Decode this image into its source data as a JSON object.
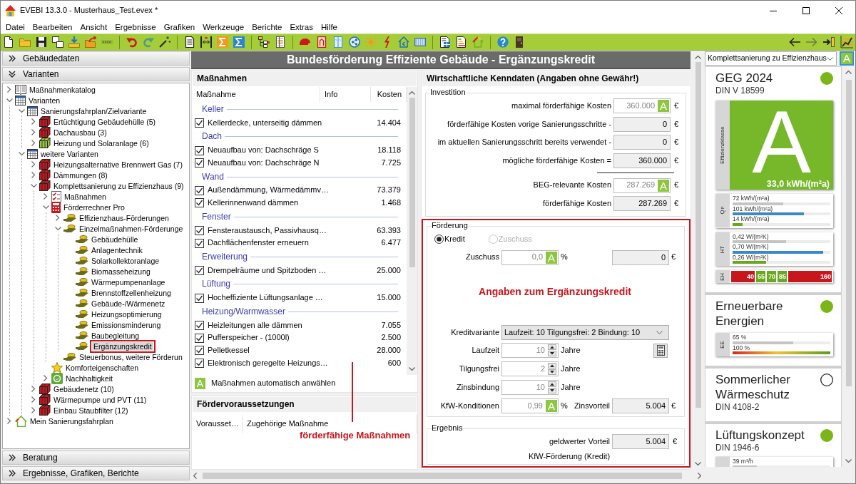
{
  "window": {
    "title": "EVEBI 13.3.0 - Musterhaus_Test.evex *"
  },
  "menu": [
    "Datei",
    "Bearbeiten",
    "Ansicht",
    "Ergebnisse",
    "Grafiken",
    "Werkzeuge",
    "Berichte",
    "Extras",
    "Hilfe"
  ],
  "sidebar": {
    "top_sections": [
      {
        "title": "Gebäudedaten",
        "expanded": false
      },
      {
        "title": "Varianten",
        "expanded": true
      }
    ],
    "tree": [
      {
        "label": "Maßnahmenkatalog",
        "kind": "catalog",
        "expanded": false,
        "selected": false
      },
      {
        "label": "Varianten",
        "kind": "group",
        "expanded": true,
        "selected": false,
        "children": [
          {
            "label": "Sanierungsfahrplan/Zielvariante",
            "kind": "group",
            "expanded": true,
            "selected": false,
            "children": [
              {
                "label": "Ertüchtigung Gebäudehülle (5)",
                "kind": "variant",
                "color": "#c8161d",
                "expanded": false,
                "selected": false
              },
              {
                "label": "Dachausbau (3)",
                "kind": "variant",
                "color": "#c8161d",
                "expanded": false,
                "selected": false
              },
              {
                "label": "Heizung und Solaranlage (6)",
                "kind": "variant",
                "color": "#9bc53d",
                "expanded": false,
                "selected": false
              }
            ]
          },
          {
            "label": "weitere Varianten",
            "kind": "group",
            "expanded": true,
            "selected": false,
            "children": [
              {
                "label": "Heizungsalternative Brennwert Gas (7)",
                "kind": "variant",
                "color": "#c8161d",
                "expanded": false,
                "selected": false
              },
              {
                "label": "Dämmungen (8)",
                "kind": "variant",
                "color": "#c8161d",
                "expanded": false,
                "selected": false
              },
              {
                "label": "Komplettsanierung zu Effizienzhaus (9)",
                "kind": "variant",
                "color": "#c8161d",
                "expanded": true,
                "selected": false,
                "children": [
                  {
                    "label": "Maßnahmen",
                    "kind": "measures",
                    "expanded": false,
                    "selected": false
                  },
                  {
                    "label": "Förderrechner Pro",
                    "kind": "calculator",
                    "expanded": true,
                    "selected": false,
                    "children": [
                      {
                        "label": "Effizienzhaus-Förderungen",
                        "kind": "funding",
                        "expanded": false,
                        "selected": false
                      },
                      {
                        "label": "Einzelmaßnahmen-Förderunge",
                        "kind": "funding",
                        "expanded": true,
                        "selected": false,
                        "children": [
                          {
                            "label": "Gebäudehülle",
                            "kind": "funding",
                            "selected": false
                          },
                          {
                            "label": "Anlagentechnik",
                            "kind": "funding",
                            "selected": false
                          },
                          {
                            "label": "Solarkollektoranlage",
                            "kind": "funding",
                            "selected": false
                          },
                          {
                            "label": "Biomasseheizung",
                            "kind": "funding",
                            "selected": false
                          },
                          {
                            "label": "Wärmepumpenanlage",
                            "kind": "funding",
                            "selected": false
                          },
                          {
                            "label": "Brennstoffzellenheizung",
                            "kind": "funding",
                            "selected": false
                          },
                          {
                            "label": "Gebäude-/Wärmenetz",
                            "kind": "funding",
                            "selected": false
                          },
                          {
                            "label": "Heizungsoptimierung",
                            "kind": "funding",
                            "selected": false
                          },
                          {
                            "label": "Emissionsminderung",
                            "kind": "funding",
                            "selected": false
                          },
                          {
                            "label": "Baubegleitung",
                            "kind": "funding",
                            "selected": false
                          },
                          {
                            "label": "Ergänzungskredit",
                            "kind": "funding",
                            "selected": true,
                            "annotated": true
                          }
                        ]
                      },
                      {
                        "label": "Steuerbonus, weitere Förderun",
                        "kind": "funding",
                        "selected": false
                      }
                    ]
                  },
                  {
                    "label": "Komforteigenschaften",
                    "kind": "star",
                    "selected": false
                  },
                  {
                    "label": "Nachhaltigkeit",
                    "kind": "sustainability",
                    "expanded": false,
                    "selected": false
                  }
                ]
              },
              {
                "label": "Gebäudenetz (10)",
                "kind": "variant",
                "color": "#c8161d",
                "expanded": false,
                "selected": false
              },
              {
                "label": "Wärmepumpe und PVT (11)",
                "kind": "variant",
                "color": "#c8161d",
                "expanded": false,
                "selected": false
              },
              {
                "label": "Einbau Staubfilter (12)",
                "kind": "variant",
                "color": "#c8161d",
                "expanded": false,
                "selected": false
              }
            ]
          }
        ]
      },
      {
        "label": "Mein Sanierungsfahrplan",
        "kind": "roadmap",
        "expanded": false,
        "selected": false
      }
    ],
    "bottom_sections": [
      {
        "title": "Beratung",
        "expanded": false
      },
      {
        "title": "Ergebnisse, Grafiken, Berichte",
        "expanded": false
      }
    ]
  },
  "page_title": "Bundesförderung Effiziente Gebäude - Ergänzungskredit",
  "measures": {
    "title": "Maßnahmen",
    "columns": [
      "Maßnahme",
      "Info",
      "Kosten"
    ],
    "groups": [
      {
        "name": "Keller",
        "items": [
          {
            "label": "Kellerdecke, unterseitig dämmen",
            "cost": "14.404",
            "checked": true
          }
        ]
      },
      {
        "name": "Dach",
        "items": [
          {
            "label": "Neuaufbau von: Dachschräge S",
            "cost": "18.118",
            "checked": true
          },
          {
            "label": "Neuaufbau von: Dachschräge N",
            "cost": "7.725",
            "checked": true
          }
        ]
      },
      {
        "name": "Wand",
        "items": [
          {
            "label": "Außendämmung, Wärmedämmv…",
            "cost": "73.379",
            "checked": true
          },
          {
            "label": "Kellerinnenwand dämmen",
            "cost": "1.468",
            "checked": true
          }
        ]
      },
      {
        "name": "Fenster",
        "items": [
          {
            "label": "Fensteraustausch, Passivhausq…",
            "cost": "63.393",
            "checked": true
          },
          {
            "label": "Dachflächenfenster erneuern",
            "cost": "6.477",
            "checked": true
          }
        ]
      },
      {
        "name": "Erweiterung",
        "items": [
          {
            "label": "Drempelräume und Spitzboden …",
            "cost": "25.000",
            "checked": true
          }
        ]
      },
      {
        "name": "Lüftung",
        "items": [
          {
            "label": "Hocheffiziente Lüftungsanlage …",
            "cost": "15.000",
            "checked": true
          }
        ]
      },
      {
        "name": "Heizung/Warmwasser",
        "items": [
          {
            "label": "Heizleitungen alle dämmen",
            "cost": "7.055",
            "checked": true
          },
          {
            "label": "Pufferspeicher - (1000l)",
            "cost": "2.500",
            "checked": true
          },
          {
            "label": "Pelletkessel",
            "cost": "28.000",
            "checked": true
          },
          {
            "label": "Elektronisch geregelte Heizungs…",
            "cost": "600",
            "checked": true
          }
        ]
      }
    ],
    "auto_select": {
      "button": "A",
      "label": "Maßnahmen automatisch anwählen"
    }
  },
  "requirements": {
    "title": "Fördervoraussetzungen",
    "columns": [
      "Vorausset…",
      "Zugehörige Maßnahme"
    ]
  },
  "annotation_note": {
    "text": "förderfähige Maßnahmen"
  },
  "economics": {
    "title": "Wirtschaftliche Kenndaten (Angaben ohne Gewähr!)",
    "investment": {
      "title": "Investition",
      "rows": [
        {
          "label": "maximal förderfähige Kosten",
          "value": "360.000",
          "kind": "auto",
          "auto_button": "A",
          "unit": "€"
        },
        {
          "label": "förderfähige Kosten vorige Sanierungsschritte -",
          "value": "0",
          "kind": "output",
          "unit": "€"
        },
        {
          "label": "im aktuellen Sanierungsschritt bereits verwendet -",
          "value": "0",
          "kind": "output",
          "unit": "€"
        },
        {
          "label": "mögliche förderfähige Kosten =",
          "value": "360.000",
          "kind": "output",
          "unit": "€"
        },
        {
          "label": "BEG-relevante Kosten",
          "value": "287.269",
          "kind": "auto",
          "auto_button": "A",
          "unit": "€",
          "divider_before": true
        },
        {
          "label": "förderfähige Kosten",
          "value": "287.269",
          "kind": "output",
          "unit": "€"
        }
      ]
    },
    "annotation_frame": true,
    "funding": {
      "title": "Förderung",
      "options": [
        {
          "label": "Kredit",
          "selected": true,
          "disabled": false
        },
        {
          "label": "Zuschuss",
          "selected": false,
          "disabled": true
        }
      ],
      "grant": {
        "label": "Zuschuss",
        "value": "0,0",
        "auto_button": "A",
        "unit": "%",
        "amount": "0",
        "amount_unit": "€"
      },
      "annotation": "Angaben zum Ergänzungskredit",
      "loan_variant": {
        "label": "Kreditvariante",
        "value": "Laufzeit: 10 Tilgungsfrei: 2 Bindung: 10"
      },
      "terms": [
        {
          "label": "Laufzeit",
          "value": "10",
          "unit": "Jahre"
        },
        {
          "label": "Tilgungsfrei",
          "value": "2",
          "unit": "Jahre"
        },
        {
          "label": "Zinsbindung",
          "value": "10",
          "unit": "Jahre"
        }
      ],
      "conditions": {
        "label": "KfW-Konditionen",
        "value": "0,99",
        "auto_button": "A",
        "unit": "%",
        "result_label": "Zinsvorteil",
        "result": "5.004",
        "result_unit": "€"
      }
    },
    "result": {
      "title": "Ergebnis",
      "label": "geldwerter Vorteil",
      "value": "5.004",
      "unit": "€",
      "note": "KfW-Förderung (Kredit)"
    }
  },
  "rating_panel": {
    "variant": "Komplettsanierung zu Effizienzhaus",
    "auto_button": "A",
    "cards": [
      {
        "title": "GEG 2024",
        "subtitle": "DIN V 18599",
        "fulfilled": true,
        "efficiency": {
          "axis_label": "Effizienzklasse",
          "grade": "A",
          "value": "33,0 kWh/(m²a)"
        },
        "meters": [
          {
            "axis_label": "Q$_{P}$",
            "bars": [
              {
                "label": "72 kWh/(m²a)",
                "level": 0.52,
                "kind": "reference"
              },
              {
                "label": "101 kWh/(m²a)",
                "level": 0.73,
                "kind": "limit"
              },
              {
                "label": "14 kWh/(m²a)",
                "level": 0.1,
                "kind": "actual"
              }
            ]
          },
          {
            "axis_label": "HT",
            "bars": [
              {
                "label": "0,42 W/(m²K)",
                "level": 0.55,
                "kind": "reference"
              },
              {
                "label": "0,70 W/(m²K)",
                "level": 0.93,
                "kind": "limit"
              },
              {
                "label": "0,26 W/(m²K)",
                "level": 0.34,
                "kind": "actual"
              }
            ]
          }
        ],
        "scale": {
          "axis_label": "EH",
          "segments": [
            {
              "label": "40",
              "reached": false
            },
            {
              "label": "55",
              "reached": true
            },
            {
              "label": "70",
              "reached": true
            },
            {
              "label": "85",
              "reached": true
            },
            {
              "label": "160",
              "reached": false
            }
          ]
        }
      },
      {
        "title": "Erneuerbare Energien",
        "fulfilled": true,
        "meters": [
          {
            "axis_label": "EE",
            "bars": [
              {
                "label": "65 %",
                "level": 0.62,
                "kind": "reference"
              },
              {
                "label": "100 %",
                "kind": "scale"
              }
            ]
          }
        ]
      },
      {
        "title": "Sommerlicher Wärmeschutz",
        "subtitle": "DIN 4108-2",
        "fulfilled": false
      },
      {
        "title": "Lüftungskonzept",
        "subtitle": "DIN 1946-6",
        "fulfilled": true,
        "meters": [
          {
            "bars": [
              {
                "label": "39 m³/h",
                "level": 0.25,
                "kind": "reference"
              }
            ]
          }
        ]
      }
    ]
  }
}
